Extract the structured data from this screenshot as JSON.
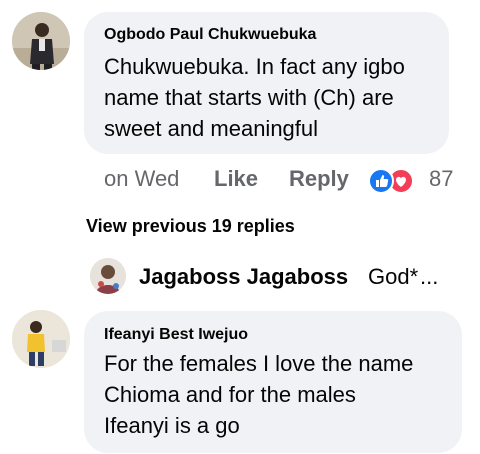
{
  "comment1": {
    "author": "Ogbodo Paul Chukwuebuka",
    "lines": [
      "Chukwuebuka. In fact any igbo",
      "name that starts with (Ch) are",
      "sweet and meaningful"
    ],
    "time": "on Wed",
    "like_label": "Like",
    "reply_label": "Reply",
    "reaction_count": "87",
    "reactions": [
      "like-icon",
      "love-icon"
    ]
  },
  "view_previous": "View previous 19 replies",
  "collapsed_reply": {
    "author": "Jagaboss Jagaboss",
    "snippet": "God*",
    "ellipsis": "..."
  },
  "comment2": {
    "author": "Ifeanyi Best Iwejuo",
    "lines": [
      "For the females I love the name",
      "Chioma and for the males",
      "Ifeanyi is a go"
    ]
  },
  "colors": {
    "bubble": "#f0f2f5",
    "meta_text": "#65676b",
    "like_blue": "#1877f2",
    "love_red": "#f33e58"
  }
}
